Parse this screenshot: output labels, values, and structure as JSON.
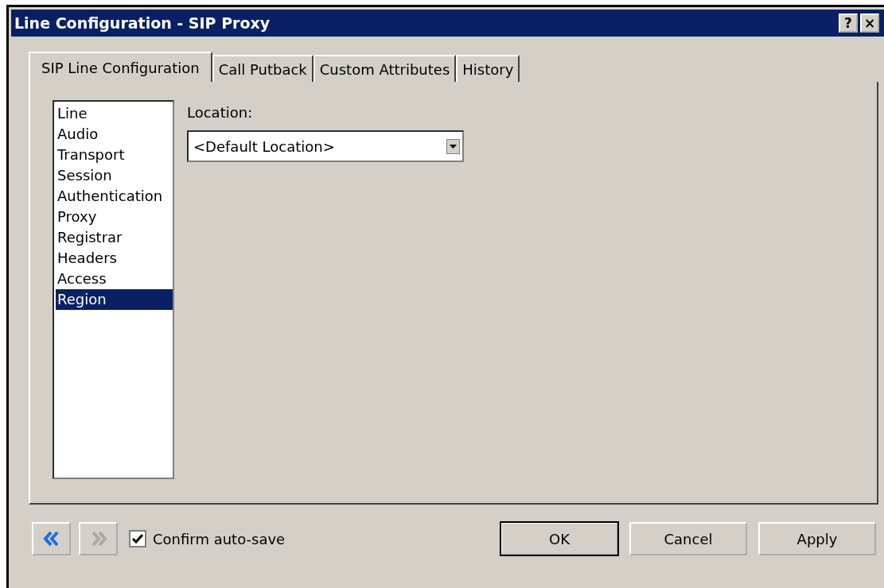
{
  "window": {
    "title": "Line Configuration - SIP Proxy",
    "help_button": "?",
    "close_button": "×"
  },
  "tabs": [
    {
      "label": "SIP Line Configuration",
      "selected": true
    },
    {
      "label": "Call Putback",
      "selected": false
    },
    {
      "label": "Custom Attributes",
      "selected": false
    },
    {
      "label": "History",
      "selected": false
    }
  ],
  "categories": [
    {
      "label": "Line",
      "selected": false
    },
    {
      "label": "Audio",
      "selected": false
    },
    {
      "label": "Transport",
      "selected": false
    },
    {
      "label": "Session",
      "selected": false
    },
    {
      "label": "Authentication",
      "selected": false
    },
    {
      "label": "Proxy",
      "selected": false
    },
    {
      "label": "Registrar",
      "selected": false
    },
    {
      "label": "Headers",
      "selected": false
    },
    {
      "label": "Access",
      "selected": false
    },
    {
      "label": "Region",
      "selected": true
    }
  ],
  "location": {
    "label": "Location:",
    "value": "<Default Location>"
  },
  "navigation": {
    "back_disabled": false,
    "forward_disabled": true
  },
  "confirm_autosave": {
    "label": "Confirm auto-save",
    "checked": true
  },
  "buttons": [
    {
      "label": "OK",
      "default": true
    },
    {
      "label": "Cancel",
      "default": false
    },
    {
      "label": "Apply",
      "default": false
    }
  ]
}
